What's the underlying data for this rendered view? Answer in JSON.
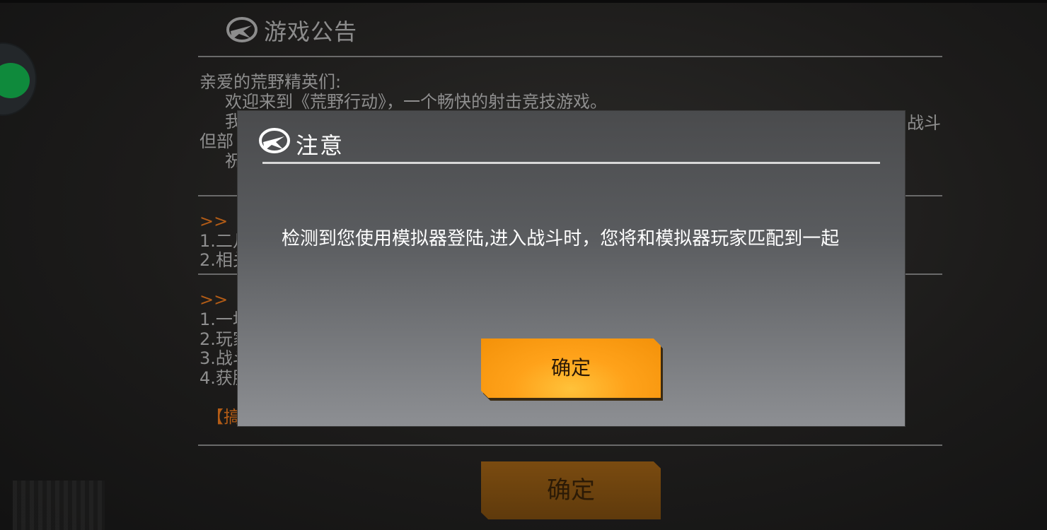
{
  "announcement": {
    "title": "游戏公告",
    "greeting": "亲爱的荒野精英们:",
    "line1": "欢迎来到《荒野行动》，一个畅快的射击竞技游戏。",
    "line2_prefix": "我",
    "line2_suffix": "战斗",
    "line3_prefix": "但部",
    "line4_prefix": "祝",
    "section1_marker": ">> 【",
    "section1_items": [
      "1.二凡",
      "2.相关"
    ],
    "section2_marker": ">> 【",
    "section2_items": [
      "1.一场",
      "2.玩家",
      "3.战斗",
      "4.获胜"
    ],
    "section3_marker": "【搞",
    "ok_label": "确定"
  },
  "modal": {
    "title": "注意",
    "message": "检测到您使用模拟器登陆,进入战斗时，您将和模拟器玩家匹配到一起",
    "ok_label": "确定"
  },
  "colors": {
    "accent_orange": "#ffa21a",
    "floating_green": "#0f8a3c",
    "modal_text": "#ffffff"
  }
}
